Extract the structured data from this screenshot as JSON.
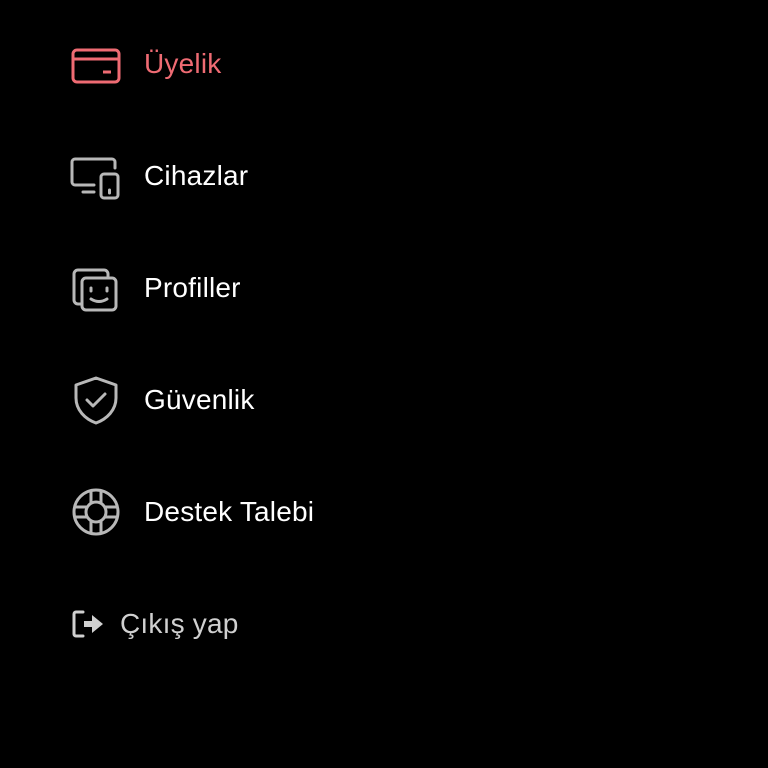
{
  "colors": {
    "background": "#000000",
    "accent": "#ef6b73",
    "icon": "#b8b8b8",
    "text": "#ffffff"
  },
  "menu": {
    "items": [
      {
        "label": "Üyelik",
        "icon": "credit-card-icon",
        "active": true
      },
      {
        "label": "Cihazlar",
        "icon": "devices-icon",
        "active": false
      },
      {
        "label": "Profiller",
        "icon": "profiles-icon",
        "active": false
      },
      {
        "label": "Güvenlik",
        "icon": "shield-check-icon",
        "active": false
      },
      {
        "label": "Destek Talebi",
        "icon": "lifebuoy-icon",
        "active": false
      }
    ],
    "logout": {
      "label": "Çıkış yap",
      "icon": "sign-out-icon"
    }
  }
}
